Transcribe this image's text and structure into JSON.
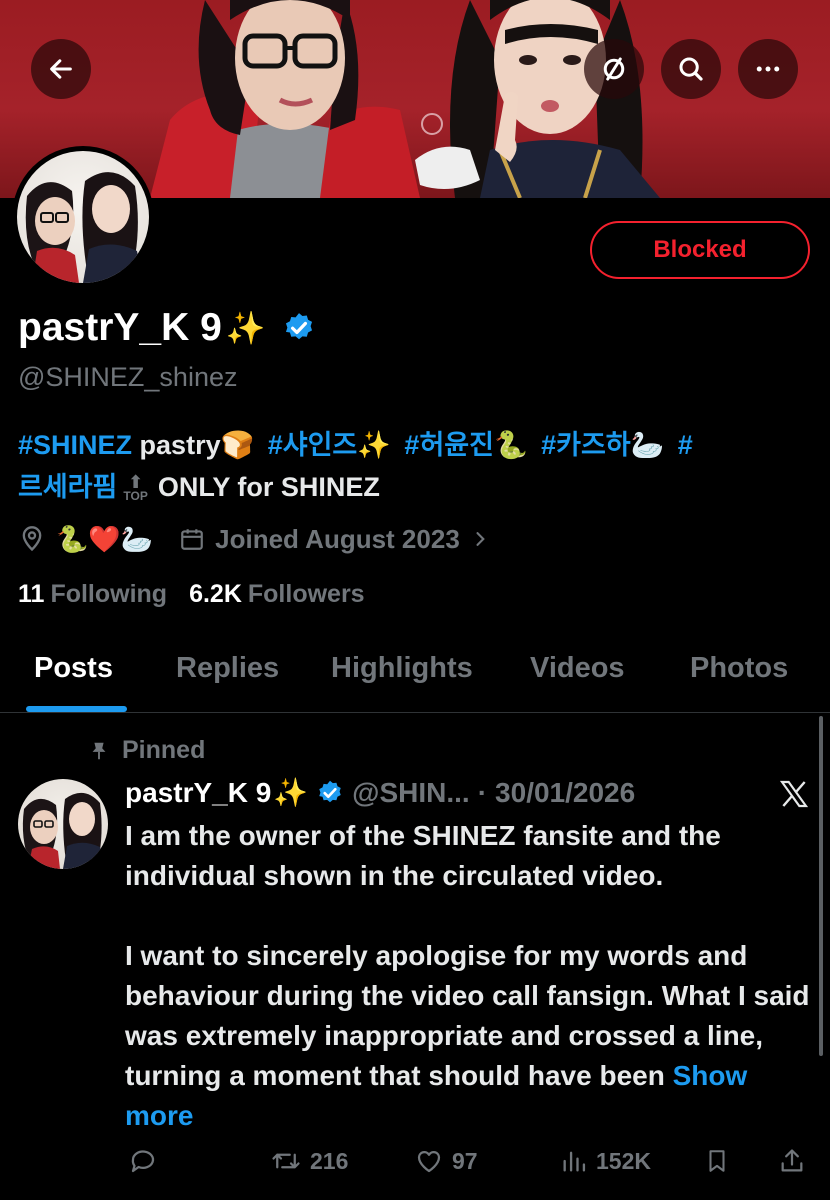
{
  "profile": {
    "display_name": "pastrY_K 9",
    "display_emoji": "✨",
    "handle": "@SHINEZ_shinez",
    "relationship_button": "Blocked",
    "bio": {
      "tag1": "#SHINEZ",
      "word1": "pastry",
      "emoji1": "🍞",
      "tag2": "#샤인즈",
      "emoji2": "✨",
      "tag3": "#허윤진",
      "emoji3": "🐍",
      "tag4": "#카즈하",
      "emoji4": "🦢",
      "tag5_line1": "#",
      "tag5_line2": "르세라핌",
      "top_label": "TOP",
      "tail": "ONLY for SHINEZ"
    },
    "location_emojis": "🐍❤️🦢",
    "joined": "Joined August 2023",
    "following_count": "11",
    "following_label": "Following",
    "followers_count": "6.2K",
    "followers_label": "Followers"
  },
  "tabs": [
    "Posts",
    "Replies",
    "Highlights",
    "Videos",
    "Photos"
  ],
  "active_tab": "Posts",
  "pinned_post": {
    "pinned_label": "Pinned",
    "author_name": "pastrY_K 9",
    "author_emoji": "✨",
    "author_handle": "@SHIN...",
    "separator": "·",
    "date": "30/01/2026",
    "paragraph1": "I am the owner of the SHINEZ fansite and the individual shown in the circulated video.",
    "paragraph2": "I want to sincerely apologise for my words and behaviour during the video call fansign. What I said was extremely inappropriate and crossed a line, turning a moment that should have been",
    "show_more": "Show more",
    "retweets": "216",
    "likes": "97",
    "views": "152K"
  },
  "icons": [
    "back-arrow-icon",
    "repost-off-icon",
    "search-icon",
    "more-icon",
    "verified-badge-icon",
    "location-icon",
    "calendar-icon",
    "chevron-right-icon",
    "pin-icon",
    "x-logo-icon",
    "reply-icon",
    "retweet-icon",
    "like-icon",
    "views-icon",
    "bookmark-icon",
    "share-icon"
  ],
  "colors": {
    "accent": "#1d9bf0",
    "blocked_red": "#f4212e",
    "muted": "#71767b",
    "banner_red": "#a5222a"
  }
}
